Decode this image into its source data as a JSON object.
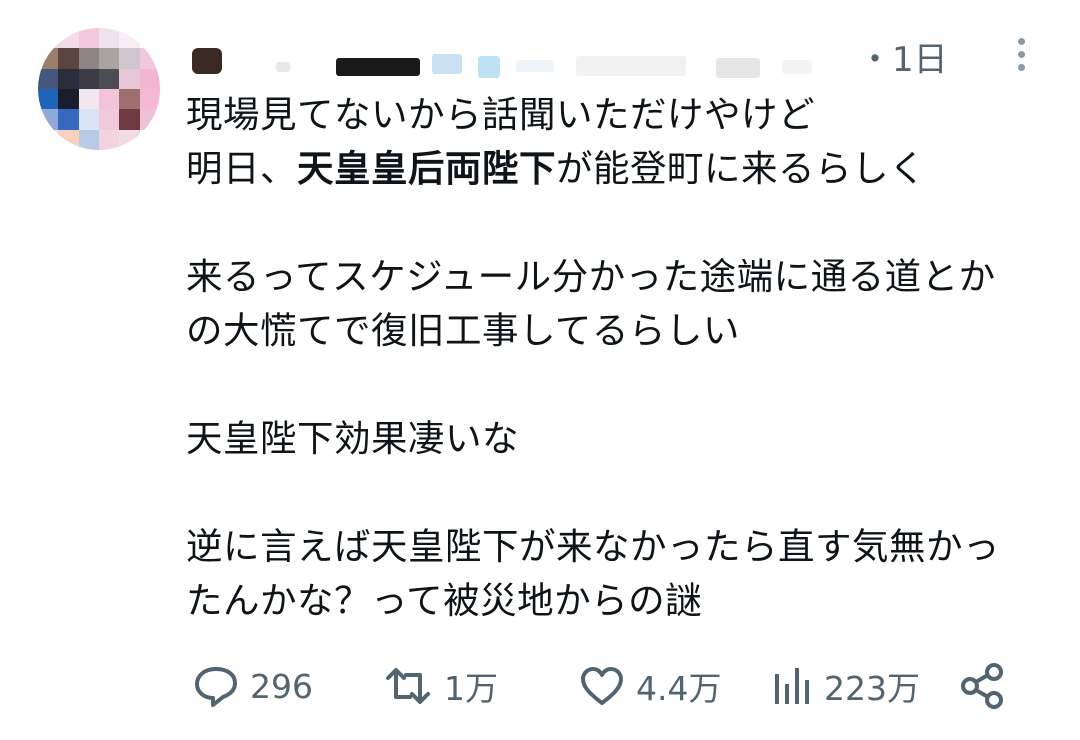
{
  "tweet": {
    "timestamp": "・1日",
    "body": {
      "l1": "現場見てないから話聞いただけやけど",
      "l2_pre": "明日、",
      "l2_bold": "天皇皇后両陛下",
      "l2_post": "が能登町に来るらしく",
      "l3": "来るってスケジュール分かった途端に通る道とか",
      "l4": "の大慌てで復旧工事してるらしい",
      "l5": "天皇陛下効果凄いな",
      "l6": "逆に言えば天皇陛下が来なかったら直す気無かっ",
      "l7": "たんかな？って被災地からの謎"
    },
    "actions": {
      "reply_count": "296",
      "retweet_count": "1万",
      "like_count": "4.4万",
      "view_count": "223万"
    }
  },
  "icons": {
    "reply": "speech-bubble-icon",
    "retweet": "retweet-icon",
    "like": "heart-icon",
    "views": "bar-chart-icon",
    "share": "share-icon",
    "more": "more-vertical-icon"
  },
  "colors": {
    "text": "#0f1419",
    "secondary": "#536471"
  }
}
